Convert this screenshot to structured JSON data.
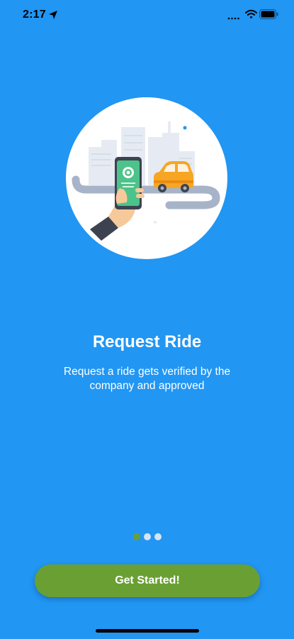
{
  "status_bar": {
    "time": "2:17"
  },
  "onboarding": {
    "title": "Request Ride",
    "description": "Request a ride gets verified by the company and approved",
    "page_indicator": {
      "total": 3,
      "active_index": 0
    },
    "cta_label": "Get Started!"
  },
  "colors": {
    "background": "#2196F3",
    "accent": "#6AA033",
    "inactive_dot": "#D6E4F3"
  },
  "icons": [
    "location-arrow-icon",
    "cellular-signal-icon",
    "wifi-icon",
    "battery-icon"
  ]
}
